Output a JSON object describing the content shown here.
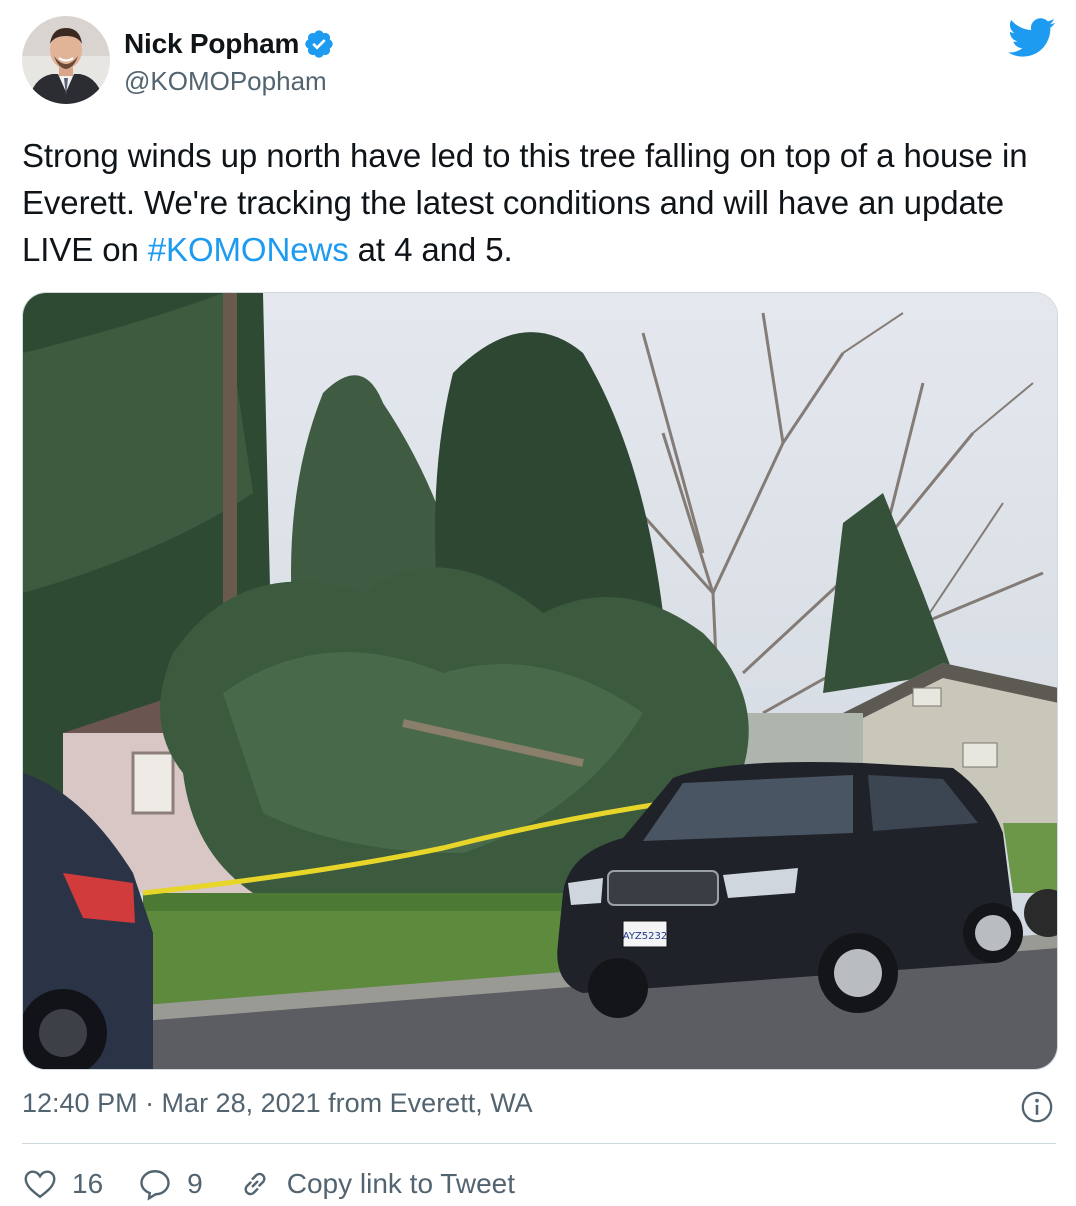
{
  "user": {
    "display_name": "Nick Popham",
    "handle": "@KOMOPopham",
    "verified": true
  },
  "tweet": {
    "text_before": "Strong winds up north have led to this tree falling on top of a house in Everett. We're tracking the latest conditions and will have an update LIVE on ",
    "hashtag": "#KOMONews",
    "text_after": " at 4 and 5."
  },
  "media": {
    "plate": "AYZ5232"
  },
  "meta": {
    "timestamp": "12:40 PM · Mar 28, 2021 from Everett, WA"
  },
  "actions": {
    "likes": "16",
    "replies": "9",
    "copy_link": "Copy link to Tweet"
  },
  "colors": {
    "accent": "#1d9bf0",
    "secondary_text": "#536471"
  },
  "icons": [
    "verified-badge-icon",
    "twitter-bird-icon",
    "info-icon",
    "heart-icon",
    "reply-icon",
    "link-icon"
  ]
}
